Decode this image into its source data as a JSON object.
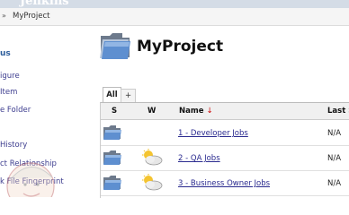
{
  "header": {
    "logo_text": "Jenkins"
  },
  "breadcrumb": {
    "separator": "»",
    "project": "MyProject"
  },
  "sidebar": {
    "heading": "us",
    "items": [
      {
        "label": "igure"
      },
      {
        "label": "Item"
      },
      {
        "label": "e Folder"
      },
      {
        "label": "History"
      },
      {
        "label": "ct Relationship"
      },
      {
        "label": "k File Fingerprint"
      }
    ]
  },
  "page": {
    "title": "MyProject"
  },
  "tabs": {
    "all": "All",
    "add": "+"
  },
  "table": {
    "headers": {
      "s": "S",
      "w": "W",
      "name": "Name",
      "sort_arrow": "↓",
      "last": "Last S"
    },
    "rows": [
      {
        "name": "1 - Developer Jobs",
        "last": "N/A",
        "weather": "none"
      },
      {
        "name": "2 - QA Jobs",
        "last": "N/A",
        "weather": "cloudy-sun"
      },
      {
        "name": "3 - Business Owner Jobs",
        "last": "N/A",
        "weather": "cloudy-sun"
      }
    ]
  },
  "icons": {
    "folder": "folder-icon",
    "weather": "weather-cloudy-icon",
    "butler": "jenkins-butler-logo"
  }
}
